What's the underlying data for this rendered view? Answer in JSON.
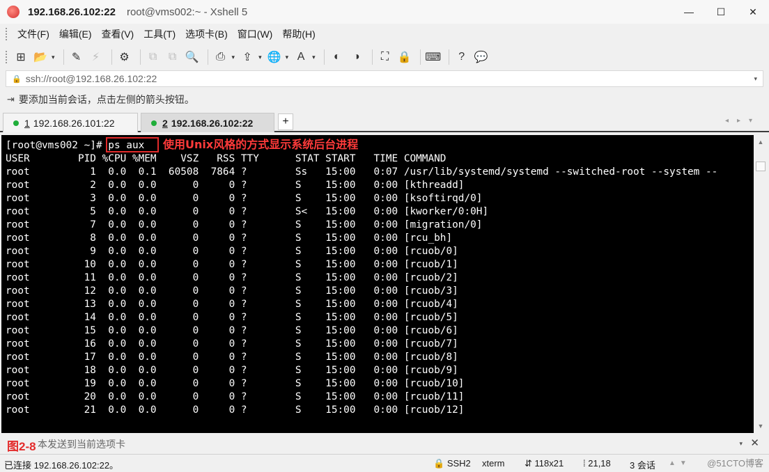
{
  "window": {
    "title_host": "192.168.26.102:22",
    "title_rest": "root@vms002:~ - Xshell 5",
    "minimize": "—",
    "maximize": "☐",
    "close": "✕"
  },
  "menu": [
    "文件(F)",
    "编辑(E)",
    "查看(V)",
    "工具(T)",
    "选项卡(B)",
    "窗口(W)",
    "帮助(H)"
  ],
  "toolbar": {
    "new_session": "⊞",
    "open": "📂",
    "reconnect": "✎",
    "disconnect": "⚡",
    "properties": "⚙",
    "copy": "⧉",
    "paste": "⧉",
    "find": "🔍",
    "print": "⎙",
    "transfer": "⇪",
    "globe": "🌐",
    "font": "A",
    "xftp": "◐",
    "tunnel": "◑",
    "fullscreen": "⛶",
    "lock": "🔒",
    "keyboard": "⌨",
    "help": "?",
    "chat": "💬"
  },
  "address": {
    "value": "ssh://root@192.168.26.102:22",
    "lock_icon": "🔒"
  },
  "hint": {
    "text": "要添加当前会话，点击左侧的箭头按钮。"
  },
  "tabs": [
    {
      "num": "1",
      "label": "192.168.26.101:22"
    },
    {
      "num": "2",
      "label": "192.168.26.102:22"
    }
  ],
  "tab_add": "+",
  "terminal": {
    "lines": [
      "[root@vms002 ~]# ps aux",
      "USER        PID %CPU %MEM    VSZ   RSS TTY      STAT START   TIME COMMAND",
      "root          1  0.0  0.1  60508  7864 ?        Ss   15:00   0:07 /usr/lib/systemd/systemd --switched-root --system --",
      "root          2  0.0  0.0      0     0 ?        S    15:00   0:00 [kthreadd]",
      "root          3  0.0  0.0      0     0 ?        S    15:00   0:00 [ksoftirqd/0]",
      "root          5  0.0  0.0      0     0 ?        S<   15:00   0:00 [kworker/0:0H]",
      "root          7  0.0  0.0      0     0 ?        S    15:00   0:00 [migration/0]",
      "root          8  0.0  0.0      0     0 ?        S    15:00   0:00 [rcu_bh]",
      "root          9  0.0  0.0      0     0 ?        S    15:00   0:00 [rcuob/0]",
      "root         10  0.0  0.0      0     0 ?        S    15:00   0:00 [rcuob/1]",
      "root         11  0.0  0.0      0     0 ?        S    15:00   0:00 [rcuob/2]",
      "root         12  0.0  0.0      0     0 ?        S    15:00   0:00 [rcuob/3]",
      "root         13  0.0  0.0      0     0 ?        S    15:00   0:00 [rcuob/4]",
      "root         14  0.0  0.0      0     0 ?        S    15:00   0:00 [rcuob/5]",
      "root         15  0.0  0.0      0     0 ?        S    15:00   0:00 [rcuob/6]",
      "root         16  0.0  0.0      0     0 ?        S    15:00   0:00 [rcuob/7]",
      "root         17  0.0  0.0      0     0 ?        S    15:00   0:00 [rcuob/8]",
      "root         18  0.0  0.0      0     0 ?        S    15:00   0:00 [rcuob/9]",
      "root         19  0.0  0.0      0     0 ?        S    15:00   0:00 [rcuob/10]",
      "root         20  0.0  0.0      0     0 ?        S    15:00   0:00 [rcuob/11]",
      "root         21  0.0  0.0      0     0 ?        S    15:00   0:00 [rcuob/12]"
    ],
    "annotation": "使用Unix风格的方式显示系统后台进程"
  },
  "send_bar": {
    "figure_label": "图2-8",
    "text": "本发送到当前选项卡"
  },
  "status": {
    "connection": "已连接 192.168.26.102:22。",
    "protocol": "SSH2",
    "term_type": "xterm",
    "size": "118x21",
    "cursor": "21,18",
    "sessions": "3 会话"
  },
  "watermark": "@51CTO博客",
  "colors": {
    "terminal_bg": "#000000",
    "terminal_fg": "#ffffff",
    "annotation": "#e32b2b",
    "tab_dot": "#1fae3a"
  }
}
